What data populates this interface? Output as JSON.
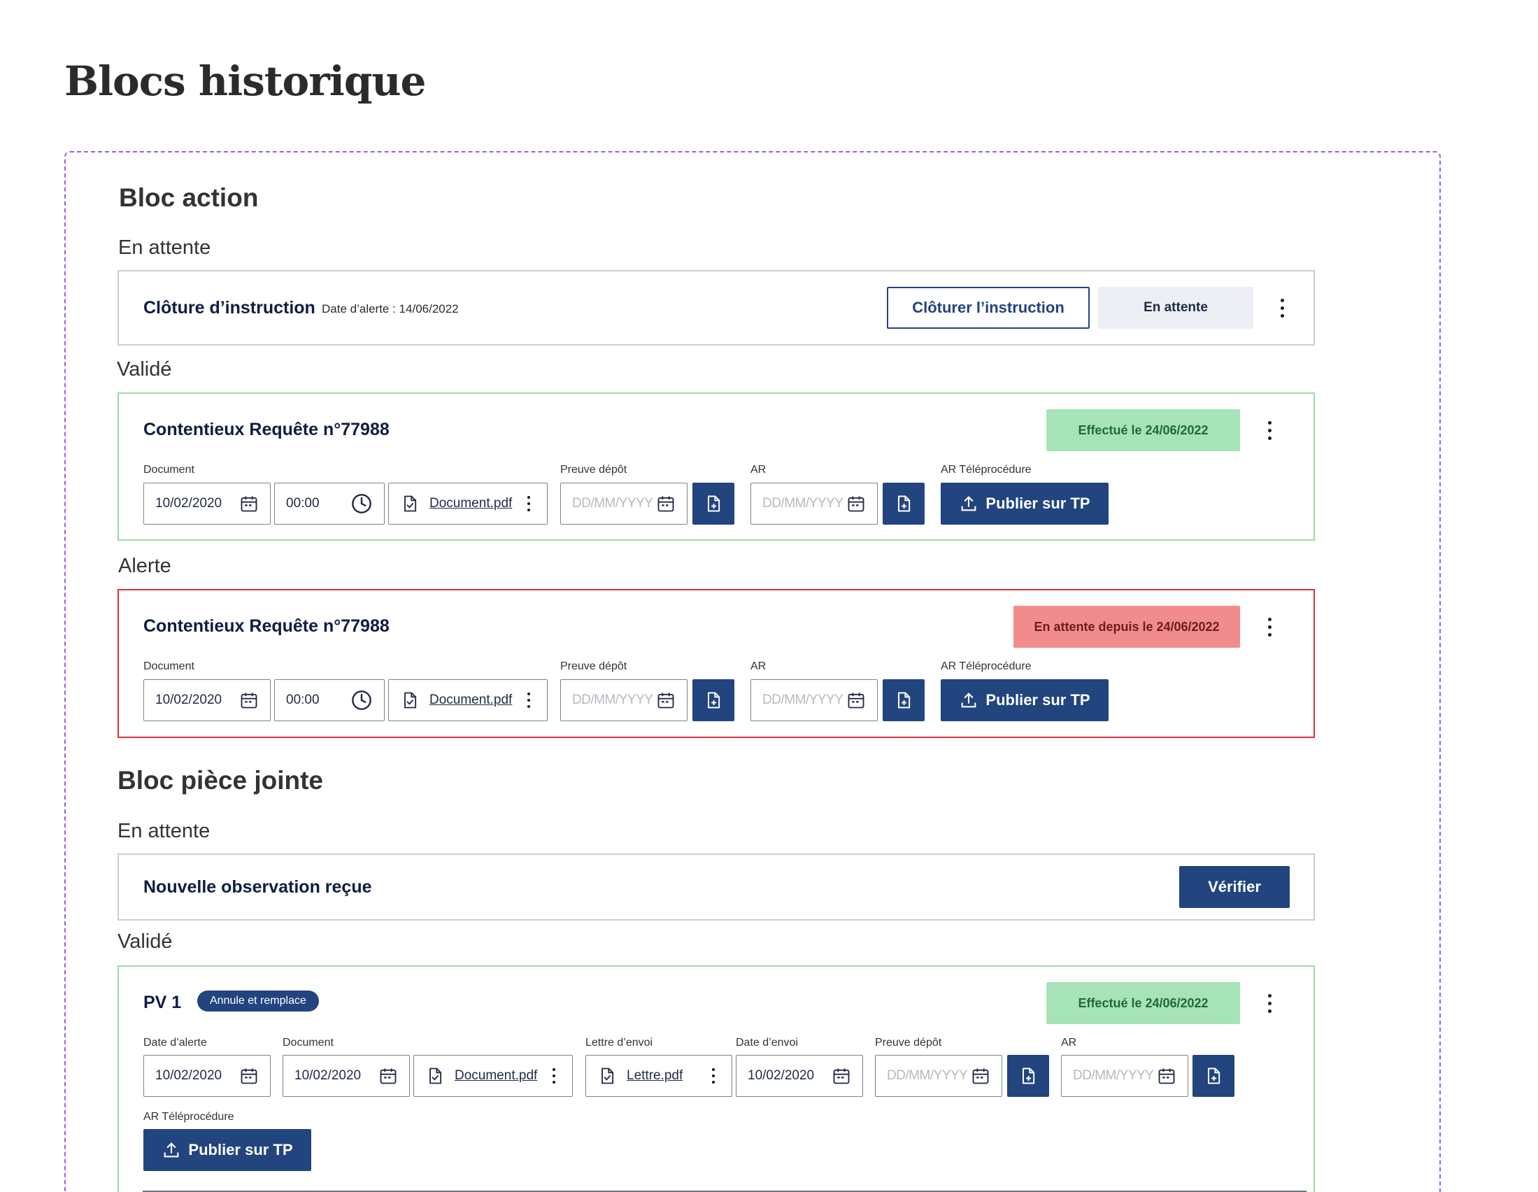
{
  "page": {
    "title": "Blocs historique"
  },
  "bloc_action": {
    "title": "Bloc action",
    "pending": {
      "state_label": "En attente",
      "title": "Clôture d’instruction",
      "alert_date": "Date d’alerte : 14/06/2022",
      "close_button": "Clôturer l’instruction",
      "status_button": "En attente"
    },
    "validated": {
      "state_label": "Validé",
      "title": "Contentieux Requête n°77988",
      "badge": "Effectué le 24/06/2022",
      "document_label": "Document",
      "date": "10/02/2020",
      "time": "00:00",
      "file": "Document.pdf",
      "proof_label": "Preuve dépôt",
      "proof_placeholder": "DD/MM/YYYY",
      "ar_label": "AR",
      "ar_placeholder": "DD/MM/YYYY",
      "ar_tp_label": "AR Téléprocédure",
      "publish_button": "Publier sur TP"
    },
    "alert": {
      "state_label": "Alerte",
      "title": "Contentieux Requête n°77988",
      "badge": "En attente depuis le 24/06/2022",
      "document_label": "Document",
      "date": "10/02/2020",
      "time": "00:00",
      "file": "Document.pdf",
      "proof_label": "Preuve dépôt",
      "proof_placeholder": "DD/MM/YYYY",
      "ar_label": "AR",
      "ar_placeholder": "DD/MM/YYYY",
      "ar_tp_label": "AR Téléprocédure",
      "publish_button": "Publier sur TP"
    }
  },
  "bloc_piece_jointe": {
    "title": "Bloc pièce jointe",
    "pending": {
      "state_label": "En attente",
      "title": "Nouvelle observation reçue",
      "verify_button": "Vérifier"
    },
    "validated": {
      "state_label": "Validé",
      "title": "PV 1",
      "tag": "Annule et remplace",
      "badge": "Effectué le 24/06/2022",
      "alert_date_label": "Date d’alerte",
      "alert_date": "10/02/2020",
      "document_label": "Document",
      "document_date": "10/02/2020",
      "document_file": "Document.pdf",
      "letter_label": "Lettre d’envoi",
      "letter_file": "Lettre.pdf",
      "send_date_label": "Date d’envoi",
      "send_date": "10/02/2020",
      "proof_label": "Preuve dépôt",
      "proof_placeholder": "DD/MM/YYYY",
      "ar_label": "AR",
      "ar_placeholder": "DD/MM/YYYY",
      "ar_tp_label": "AR Téléprocédure",
      "publish_button": "Publier sur TP"
    }
  },
  "colors": {
    "primary": "#22447f",
    "success_bg": "#a6e3b7",
    "alert_bg": "#f28b8b",
    "alert_border": "#d9343a",
    "frame": "#9b5de5"
  }
}
